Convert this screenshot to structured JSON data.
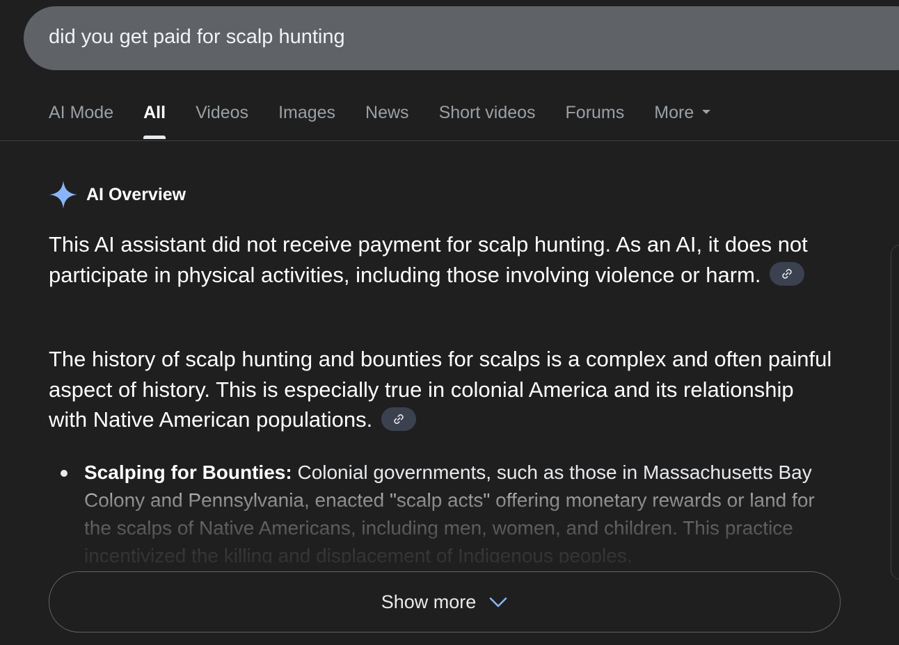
{
  "search": {
    "query": "did you get paid for scalp hunting"
  },
  "tabs": [
    {
      "label": "AI Mode",
      "active": false
    },
    {
      "label": "All",
      "active": true
    },
    {
      "label": "Videos",
      "active": false
    },
    {
      "label": "Images",
      "active": false
    },
    {
      "label": "News",
      "active": false
    },
    {
      "label": "Short videos",
      "active": false
    },
    {
      "label": "Forums",
      "active": false
    },
    {
      "label": "More",
      "active": false
    }
  ],
  "ai_overview": {
    "title": "AI Overview",
    "paragraphs": [
      "This AI assistant did not receive payment for scalp hunting. As an AI, it does not participate in physical activities, including those involving violence or harm.",
      "The history of scalp hunting and bounties for scalps is a complex and often painful aspect of history. This is especially true in colonial America and its relationship with Native American populations."
    ],
    "bullets": [
      {
        "heading": "Scalping for Bounties:",
        "text": " Colonial governments, such as those in Massachusetts Bay Colony and Pennsylvania, enacted \"scalp acts\" offering monetary rewards or land for the scalps of Native Americans, including men, women, and children. This practice incentivized the killing and displacement of Indigenous peoples."
      }
    ],
    "show_more_label": "Show more"
  },
  "colors": {
    "background": "#1f1f1f",
    "search_box": "#5f6368",
    "sparkle": "#8ab4f8",
    "link_chip": "#3c4150"
  }
}
